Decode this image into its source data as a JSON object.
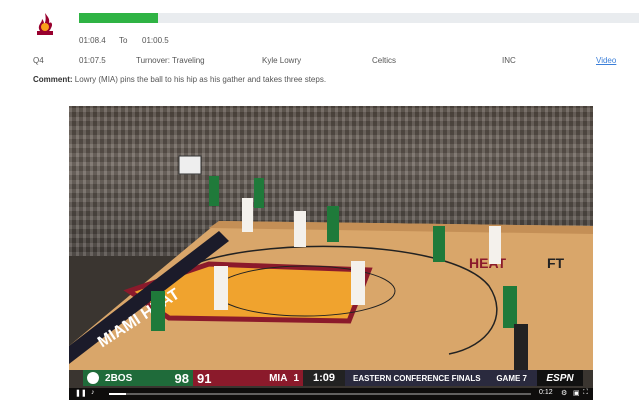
{
  "team_logo": {
    "icon": "heat-logo-icon",
    "wordmark": "MIAMI HEAT",
    "colors": {
      "primary": "#98002e",
      "accent": "#f9a01b"
    }
  },
  "progress": {
    "fraction": 0.141,
    "color": "#2fb344"
  },
  "time_range": {
    "start": "01:08.4",
    "separator": "To",
    "end": "01:00.5"
  },
  "play": {
    "period": "Q4",
    "time": "01:07.5",
    "event": "Turnover: Traveling",
    "player": "Kyle Lowry",
    "team": "Celtics",
    "status": "INC",
    "video_link": "Video"
  },
  "comment": {
    "label": "Comment:",
    "text": "Lowry (MIA) pins the ball to his hip as his gather and takes three steps."
  },
  "video": {
    "court_text": {
      "baseline": "MIAMI HEAT",
      "logo": "HEAT",
      "floor_right": "FT"
    },
    "scorebug": {
      "away_seed": "2",
      "away_team": "BOS",
      "away_score": "98",
      "home_score": "91",
      "home_team": "MIA",
      "home_seed": "1",
      "clock": "1:09",
      "series": "EASTERN CONFERENCE FINALS",
      "game": "GAME 7",
      "network": "ESPN"
    },
    "player_bar": {
      "time": "0:12",
      "progress": 0.04
    }
  }
}
